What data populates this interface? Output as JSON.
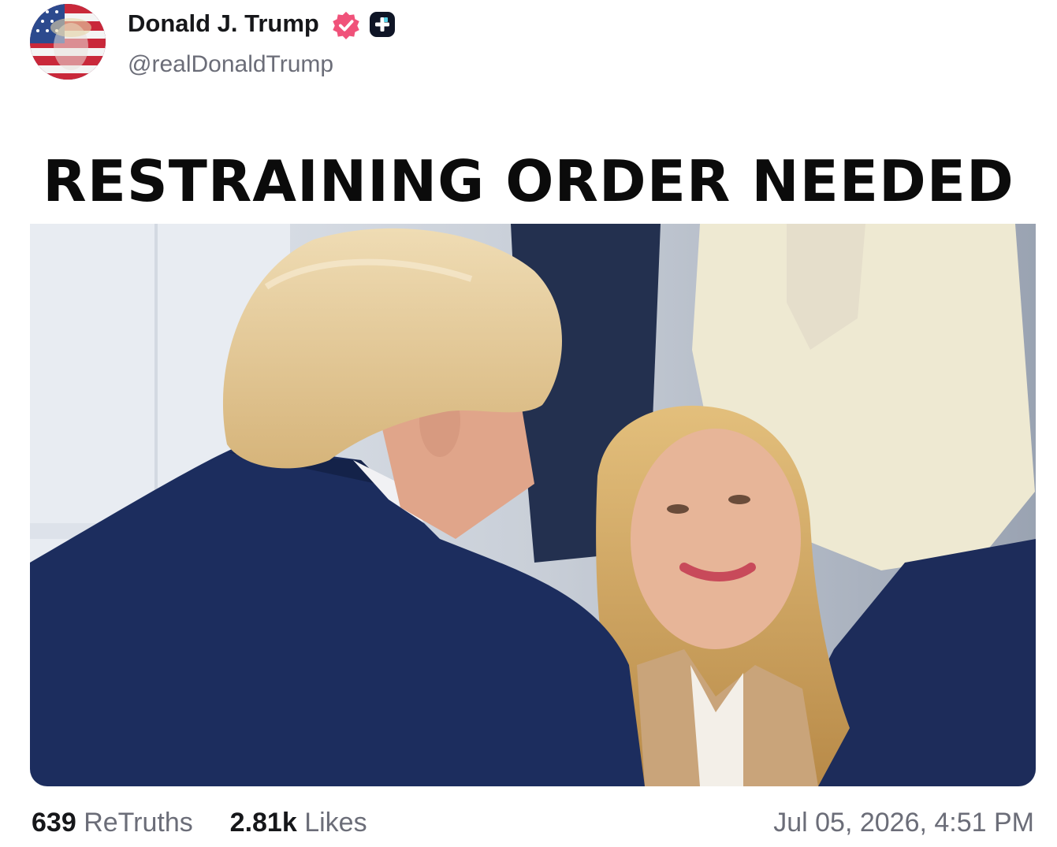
{
  "author": {
    "name": "Donald J. Trump",
    "handle": "@realDonaldTrump",
    "verified": true
  },
  "post": {
    "headline": "RESTRAINING ORDER NEEDED",
    "image_description_icon": "photo"
  },
  "footer": {
    "retruths_count": "639",
    "retruths_label": "ReTruths",
    "likes_count": "2.81k",
    "likes_label": "Likes",
    "timestamp": "Jul 05, 2026, 4:51 PM"
  },
  "colors": {
    "verified_badge": "#f0527a",
    "text_primary": "#16171a",
    "text_secondary": "#6b6d78",
    "suit_navy": "#1c2d5e"
  }
}
